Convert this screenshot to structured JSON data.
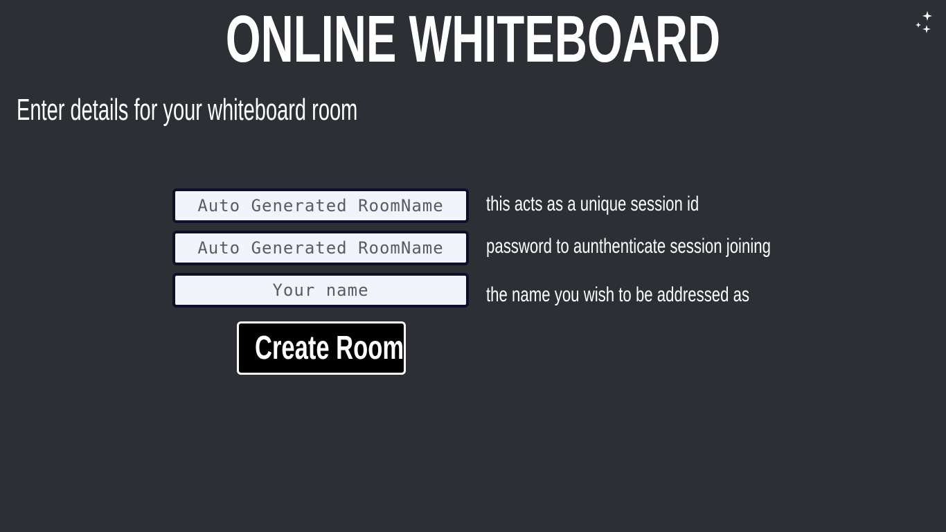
{
  "header": {
    "title": "ONLINE WHITEBOARD",
    "theme_toggle_icon": "moon-stars-icon"
  },
  "form": {
    "heading": "Enter details for your whiteboard room",
    "room_name": {
      "placeholder": "Auto Generated RoomName",
      "value": "",
      "hint": "this acts as a unique session id"
    },
    "password": {
      "placeholder": "Auto Generated RoomName",
      "value": "",
      "hint": "password to aunthenticate session joining"
    },
    "user_name": {
      "placeholder": "Your name",
      "value": "",
      "hint": "the name you wish to be addressed as"
    },
    "submit_label": "Create Room"
  },
  "colors": {
    "background": "#2c2f34",
    "input_background": "#f2f3fb",
    "input_border": "#0e0f2a",
    "button_background": "#000000",
    "text": "#ffffff"
  }
}
